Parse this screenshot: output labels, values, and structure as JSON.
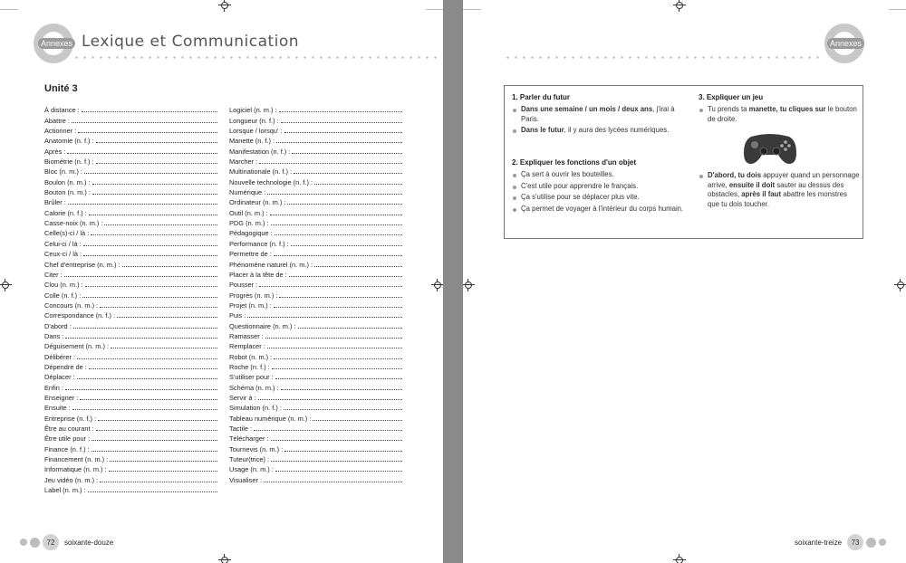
{
  "left_page": {
    "header": {
      "badge": "Annexes",
      "title": "Lexique et Communication"
    },
    "unit_title": "Unité 3",
    "column1": [
      "À distance :",
      "Abattre :",
      "Actionner :",
      "Anatomie (n. f.) :",
      "Après :",
      "Biométrie (n. f.) :",
      "Bloc (n. m.) :",
      "Boulon (n. m.) :",
      "Bouton (n. m.) :",
      "Brûler :",
      "Calorie (n. f.) :",
      "Casse-noix (n. m.) :",
      "Celle(s)-ci / là :",
      "Celui-ci / là :",
      "Ceux-ci / là :",
      "Chef d'entreprise (n. m.) :",
      "Citer :",
      "Clou (n. m.) :",
      "Colle (n. f.) :",
      "Concours (n. m.) :",
      "Correspondance (n. f.) :",
      "D'abord :",
      "Dans :",
      "Déguisement (n. m.) :",
      "Délibérer :",
      "Dépendre de :",
      "Déplacer :",
      "Enfin :",
      "Enseigner :",
      "Ensuite :",
      "Entreprise (n. f.) :",
      "Être au courant :",
      "Être utile pour :",
      "Finance (n. f.) :",
      "Financement (n. m.) :",
      "Informatique (n. m.) :",
      "Jeu vidéo (n. m.) :",
      "Label (n. m.) :"
    ],
    "column2": [
      "Logiciel (n. m.) :",
      "Longueur (n. f.) :",
      "Lorsque / lorsqu' :",
      "Manette (n. f.) :",
      "Manifestation (n. f.) :",
      "Marcher :",
      "Multinationale (n. f.) :",
      "Nouvelle technologie (n. f.) :",
      "Numérique :",
      "Ordinateur (n. m.) :",
      "Outil (n. m.) :",
      "PDG (n. m.) :",
      "Pédagogique :",
      "Performance (n. f.) :",
      "Permettre de :",
      "Phénomène naturel (n. m.) :",
      "Placer à la tête de :",
      "Pousser :",
      "Progrès (n. m.) :",
      "Projet (n. m.) :",
      "Puis :",
      "Questionnaire (n. m.) :",
      "Ramasser :",
      "Remplacer :",
      "Robot (n. m.) :",
      "Roche (n. f.) :",
      "S'utiliser pour :",
      "Schéma (n. m.) :",
      "Servir à :",
      "Simulation (n. f.) :",
      "Tableau numérique (n. m.) :",
      "Tactile :",
      "Télécharger :",
      "Tournevis (n. m.) :",
      "Tuteur(trice) :",
      "Usage (n. m.) :",
      "Visualiser :"
    ],
    "footer": {
      "number": "72",
      "text": "soixante-douze"
    }
  },
  "right_page": {
    "header": {
      "badge": "Annexes"
    },
    "section1": {
      "title": "1. Parler du futur",
      "items": [
        {
          "bold": "Dans une semaine / un mois / deux ans",
          "rest": ", j'irai à Paris."
        },
        {
          "bold": "Dans le futur",
          "rest": ", il y aura des lycées numériques."
        }
      ]
    },
    "section2": {
      "title": "2. Expliquer les fonctions d'un objet",
      "items": [
        "Ça sert à ouvrir les bouteilles.",
        "C'est utile pour apprendre le français.",
        "Ça s'utilise pour se déplacer plus vite.",
        "Ça permet de voyager à l'intérieur du corps humain."
      ]
    },
    "section3": {
      "title": "3. Expliquer un jeu",
      "item1": {
        "t1": "Tu prends ta ",
        "b1": "manette, tu cliques sur",
        "t2": " le bouton de droite."
      },
      "item2": {
        "b1": "D'abord, tu dois",
        "t1": " appuyer quand un personnage arrive, ",
        "b2": "ensuite il doit",
        "t2": " sauter au dessus des obstacles, ",
        "b3": "après il faut",
        "t3": " abattre les monstres que tu dois toucher."
      }
    },
    "footer": {
      "number": "73",
      "text": "soixante-treize"
    }
  }
}
